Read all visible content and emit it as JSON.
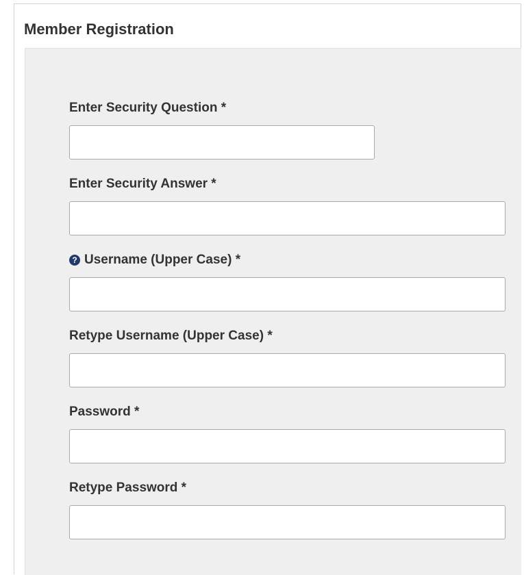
{
  "header": {
    "title": "Member Registration"
  },
  "form": {
    "fields": [
      {
        "label": "Enter Security Question *",
        "value": "",
        "placeholder": ""
      },
      {
        "label": "Enter Security Answer *",
        "value": "",
        "placeholder": ""
      },
      {
        "label": "Username (Upper Case) *",
        "value": "",
        "placeholder": "",
        "help_icon": "question-circle-icon"
      },
      {
        "label": "Retype Username (Upper Case) *",
        "value": "",
        "placeholder": ""
      },
      {
        "label": "Password *",
        "value": "",
        "placeholder": ""
      },
      {
        "label": "Retype Password *",
        "value": "",
        "placeholder": ""
      }
    ]
  },
  "colors": {
    "panel_background": "#efefef",
    "help_icon": "#1f3a6b",
    "input_border": "#a9a9a9"
  }
}
